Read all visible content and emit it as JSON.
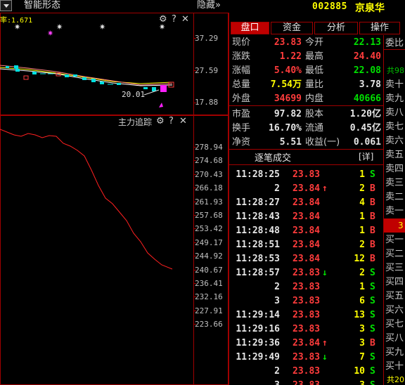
{
  "toolbar": {
    "title": "智能形态",
    "hide": "隐藏",
    "hide_chevrons": "»"
  },
  "stock": {
    "code": "002885",
    "name": "京泉华"
  },
  "kline": {
    "ma_label": "率:1.671",
    "axis": [
      "37.29",
      "27.59",
      "17.88"
    ],
    "low_marker": "20.01",
    "controls": {
      "gear": "⚙",
      "help": "?",
      "close": "✕"
    }
  },
  "main_force": {
    "label": "主力追踪",
    "axis": [
      "278.94",
      "274.68",
      "270.43",
      "266.18",
      "261.93",
      "257.68",
      "253.42",
      "249.17",
      "244.92",
      "240.67",
      "236.41",
      "232.16",
      "227.91",
      "223.66"
    ],
    "controls": {
      "gear": "⚙",
      "help": "?",
      "close": "✕"
    }
  },
  "tabs": [
    "盘口",
    "资金",
    "分析",
    "操作"
  ],
  "quote": {
    "rows": [
      {
        "l1": "现价",
        "v1": "23.83",
        "c1": "red",
        "l2": "今开",
        "v2": "22.13",
        "c2": "green"
      },
      {
        "l1": "涨跌",
        "v1": "1.22",
        "c1": "red",
        "l2": "最高",
        "v2": "24.40",
        "c2": "red"
      },
      {
        "l1": "涨幅",
        "v1": "5.40%",
        "c1": "red",
        "l2": "最低",
        "v2": "22.08",
        "c2": "green"
      },
      {
        "l1": "总量",
        "v1": "7.54万",
        "c1": "yellow",
        "l2": "量比",
        "v2": "3.78",
        "c2": "white"
      },
      {
        "l1": "外盘",
        "v1": "34699",
        "c1": "red",
        "l2": "内盘",
        "v2": "40666",
        "c2": "green"
      },
      {
        "l1": "市盈",
        "v1": "97.82",
        "c1": "white",
        "l2": "股本",
        "v2": "1.20亿",
        "c2": "white"
      },
      {
        "l1": "换手",
        "v1": "16.70%",
        "c1": "white",
        "l2": "流通",
        "v2": "0.45亿",
        "c2": "white"
      },
      {
        "l1": "净资",
        "v1": "5.51",
        "c1": "white",
        "l2": "收益(一)",
        "v2": "0.061",
        "c2": "white"
      }
    ]
  },
  "trades": {
    "title": "逐笔成交",
    "detail": "[详]",
    "rows": [
      {
        "time": "11:28:25",
        "price": "23.83",
        "arrow": "",
        "vol": "1",
        "side": "S"
      },
      {
        "time": "2",
        "price": "23.84",
        "arrow": "↑",
        "vol": "2",
        "side": "B"
      },
      {
        "time": "11:28:27",
        "price": "23.84",
        "arrow": "",
        "vol": "4",
        "side": "B"
      },
      {
        "time": "11:28:43",
        "price": "23.84",
        "arrow": "",
        "vol": "1",
        "side": "B"
      },
      {
        "time": "11:28:48",
        "price": "23.84",
        "arrow": "",
        "vol": "1",
        "side": "B"
      },
      {
        "time": "11:28:51",
        "price": "23.84",
        "arrow": "",
        "vol": "2",
        "side": "B"
      },
      {
        "time": "11:28:53",
        "price": "23.84",
        "arrow": "",
        "vol": "12",
        "side": "B"
      },
      {
        "time": "11:28:57",
        "price": "23.83",
        "arrow": "↓",
        "vol": "2",
        "side": "S"
      },
      {
        "time": "2",
        "price": "23.83",
        "arrow": "",
        "vol": "1",
        "side": "S"
      },
      {
        "time": "3",
        "price": "23.83",
        "arrow": "",
        "vol": "6",
        "side": "S"
      },
      {
        "time": "11:29:14",
        "price": "23.83",
        "arrow": "",
        "vol": "13",
        "side": "S"
      },
      {
        "time": "11:29:16",
        "price": "23.83",
        "arrow": "",
        "vol": "3",
        "side": "S"
      },
      {
        "time": "11:29:36",
        "price": "23.84",
        "arrow": "↑",
        "vol": "3",
        "side": "B"
      },
      {
        "time": "11:29:49",
        "price": "23.83",
        "arrow": "↓",
        "vol": "7",
        "side": "S"
      },
      {
        "time": "2",
        "price": "23.83",
        "arrow": "",
        "vol": "10",
        "side": "S"
      },
      {
        "time": "3",
        "price": "23.83",
        "arrow": "",
        "vol": "3",
        "side": "S"
      }
    ]
  },
  "orderbook": {
    "head": "委比",
    "total_top": "共98",
    "sells": [
      "卖十",
      "卖九",
      "卖八",
      "卖七",
      "卖六",
      "卖五",
      "卖四",
      "卖三",
      "卖二",
      "卖一"
    ],
    "current": "3",
    "buys": [
      "买一",
      "买二",
      "买三",
      "买四",
      "买五",
      "买六",
      "买七",
      "买八",
      "买九",
      "买十"
    ],
    "total_bottom": "共20"
  },
  "colors": {
    "up": "#ff3c3c",
    "down": "#00e000",
    "border": "#a00000",
    "accent": "#ffff00"
  }
}
